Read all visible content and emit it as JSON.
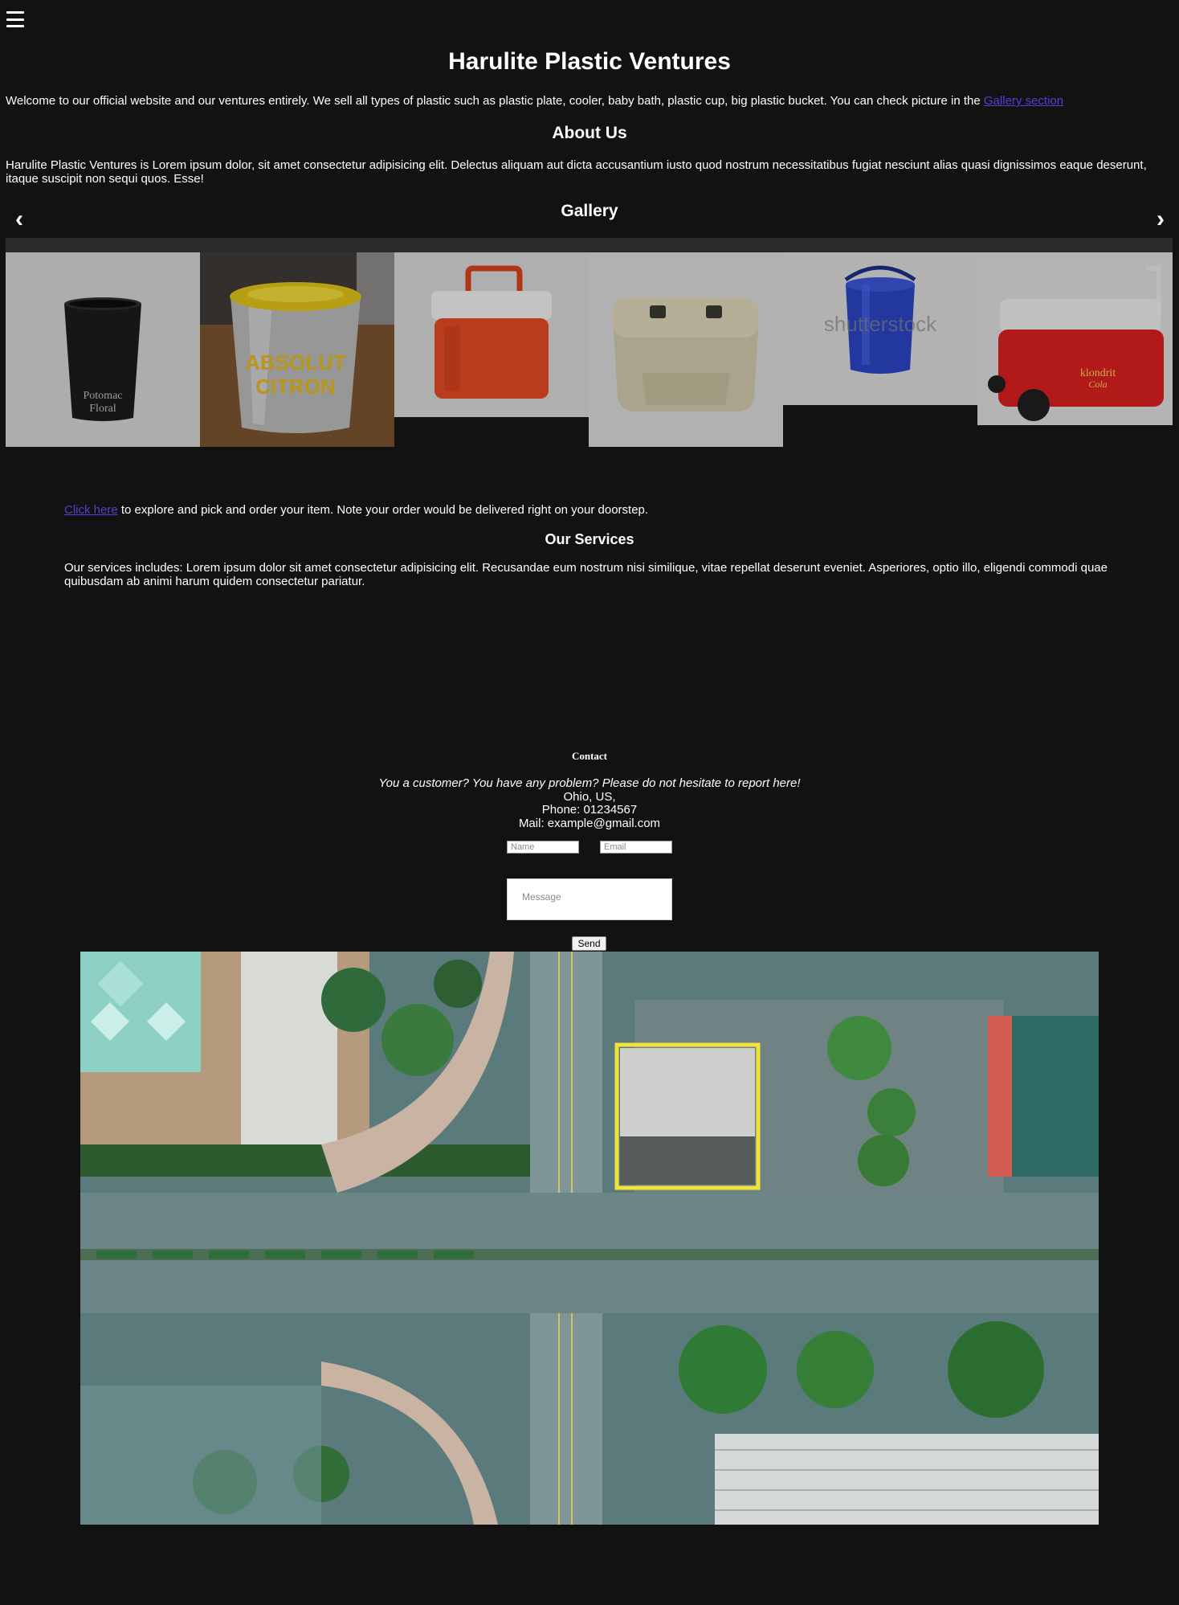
{
  "header": {
    "menu_icon": "hamburger-icon"
  },
  "site": {
    "title": "Harulite Plastic Ventures"
  },
  "intro": {
    "text": "Welcome to our official website and our ventures entirely. We sell all types of plastic such as plastic plate, cooler, baby bath, plastic cup, big plastic bucket. You can check picture in the ",
    "link_text": "Gallery section"
  },
  "about": {
    "heading": "About Us",
    "text": "Harulite Plastic Ventures is Lorem ipsum dolor, sit amet consectetur adipisicing elit. Delectus aliquam aut dicta accusantium iusto quod nostrum necessitatibus fugiat nesciunt alias quasi dignissimos eaque deserunt, itaque suscipit non sequi quos. Esse!"
  },
  "gallery": {
    "heading": "Gallery",
    "prev_label": "‹",
    "next_label": "›",
    "items": [
      {
        "label_lines": [
          "Potomac",
          "Floral"
        ]
      },
      {
        "label_lines": [
          "ABSOLUT",
          "CITRON"
        ]
      },
      {
        "label_lines": []
      },
      {
        "label_lines": []
      },
      {
        "label_lines": [
          "shutterstock"
        ]
      },
      {
        "label_lines": [
          "klondrit",
          "Cola"
        ]
      }
    ]
  },
  "explore": {
    "link_text": "Click here",
    "text": " to explore and pick and order your item. Note your order would be delivered right on your doorstep."
  },
  "services": {
    "heading": "Our Services",
    "text": "Our services includes: Lorem ipsum dolor sit amet consectetur adipisicing elit. Recusandae eum nostrum nisi similique, vitae repellat deserunt eveniet. Asperiores, optio illo, eligendi commodi quae quibusdam ab animi harum quidem consectetur pariatur."
  },
  "contact": {
    "heading": "Contact",
    "tagline": "You a customer? You have any problem? Please do not hesitate to report here!",
    "location": "Ohio, US,",
    "phone": "Phone: 01234567",
    "mail": "Mail: example@gmail.com",
    "name_placeholder": "Name",
    "email_placeholder": "Email",
    "message_placeholder": "Message",
    "send_label": "Send"
  },
  "colors": {
    "background": "#121212",
    "text": "#ffffff",
    "link": "#5e3bd6"
  }
}
